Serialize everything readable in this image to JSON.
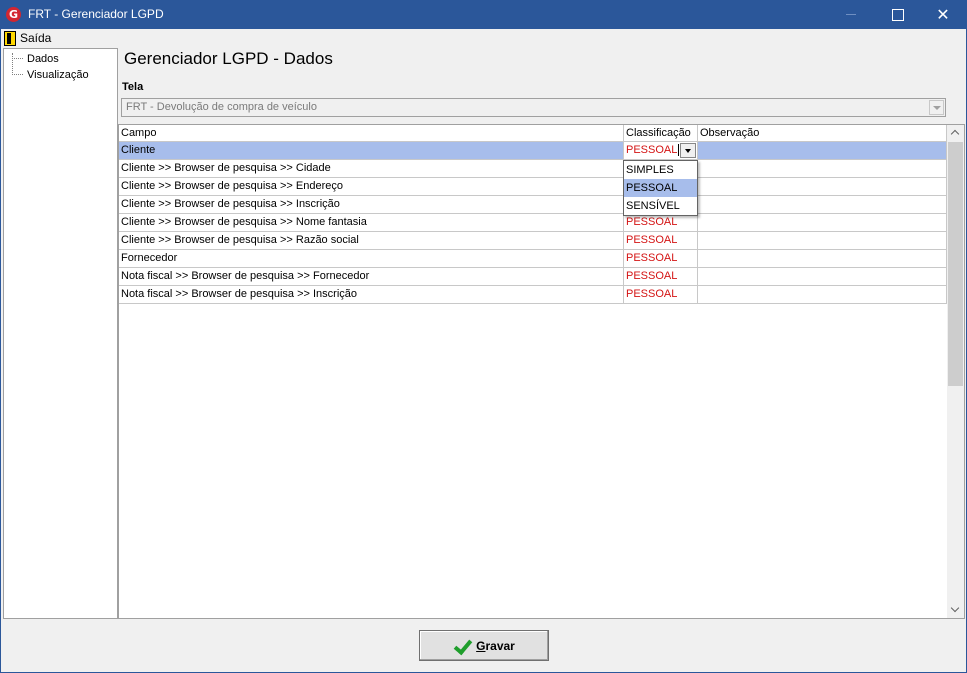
{
  "window": {
    "title": "FRT - Gerenciador LGPD",
    "app_icon_letter": "G",
    "close_glyph": "✕"
  },
  "menu": {
    "exit_label": "Saída"
  },
  "tree": {
    "items": [
      {
        "label": "Dados"
      },
      {
        "label": "Visualização"
      }
    ]
  },
  "main": {
    "title": "Gerenciador LGPD - Dados",
    "screen_label": "Tela",
    "screen_value": "FRT - Devolução de compra de veículo"
  },
  "grid": {
    "columns": [
      "Campo",
      "Classificação",
      "Observação"
    ],
    "rows": [
      {
        "campo": "Cliente",
        "classificacao": "PESSOAL",
        "observacao": ""
      },
      {
        "campo": "Cliente >> Browser de pesquisa >> Cidade",
        "classificacao": "",
        "observacao": ""
      },
      {
        "campo": "Cliente >> Browser de pesquisa >> Endereço",
        "classificacao": "",
        "observacao": ""
      },
      {
        "campo": "Cliente >> Browser de pesquisa >> Inscrição",
        "classificacao": "",
        "observacao": ""
      },
      {
        "campo": "Cliente >> Browser de pesquisa >> Nome fantasia",
        "classificacao": "PESSOAL",
        "observacao": ""
      },
      {
        "campo": "Cliente >> Browser de pesquisa >> Razão social",
        "classificacao": "PESSOAL",
        "observacao": ""
      },
      {
        "campo": "Fornecedor",
        "classificacao": "PESSOAL",
        "observacao": ""
      },
      {
        "campo": "Nota fiscal >> Browser de pesquisa >> Fornecedor",
        "classificacao": "PESSOAL",
        "observacao": ""
      },
      {
        "campo": "Nota fiscal >> Browser de pesquisa >> Inscrição",
        "classificacao": "PESSOAL",
        "observacao": ""
      }
    ],
    "dropdown_options": [
      "SIMPLES",
      "PESSOAL",
      "SENSÍVEL"
    ],
    "dropdown_highlighted": "PESSOAL"
  },
  "footer": {
    "save_label_first": "G",
    "save_label_rest": "ravar"
  },
  "colors": {
    "titlebar": "#2b579a",
    "selection": "#a7bdeb",
    "classification_text": "#d41414",
    "check": "#1f9e2c"
  },
  "icons": {
    "app": "frt-logo-icon",
    "exit": "exit-door-icon",
    "save": "checkmark-icon"
  }
}
